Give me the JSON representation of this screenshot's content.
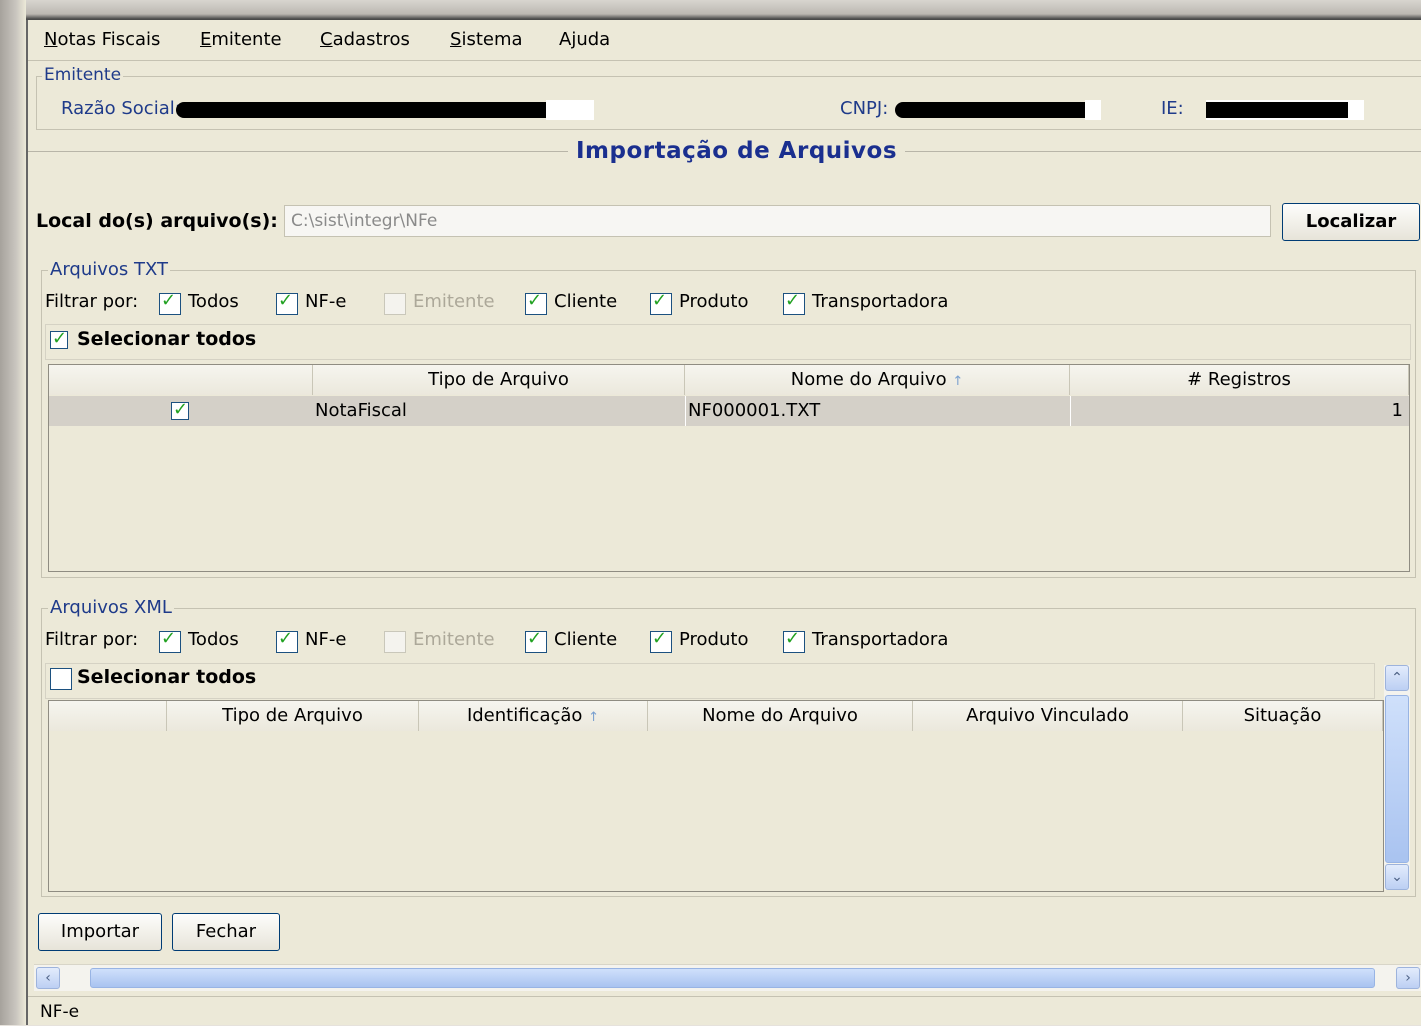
{
  "menu": {
    "items": [
      {
        "label": "Notas Fiscais"
      },
      {
        "label": "Emitente"
      },
      {
        "label": "Cadastros"
      },
      {
        "label": "Sistema"
      },
      {
        "label": "Ajuda"
      }
    ]
  },
  "emitente": {
    "title": "Emitente",
    "razao_label": "Razão Social:",
    "cnpj_label": "CNPJ:",
    "ie_label": "IE:"
  },
  "page": {
    "title": "Importação de Arquivos"
  },
  "local": {
    "label": "Local do(s) arquivo(s):",
    "value": "C:\\sist\\integr\\NFe",
    "button": "Localizar"
  },
  "txt": {
    "title": "Arquivos TXT",
    "filter_label": "Filtrar por:",
    "filters": [
      {
        "label": "Todos",
        "checked": true,
        "enabled": true
      },
      {
        "label": "NF-e",
        "checked": true,
        "enabled": true
      },
      {
        "label": "Emitente",
        "checked": false,
        "enabled": false
      },
      {
        "label": "Cliente",
        "checked": true,
        "enabled": true
      },
      {
        "label": "Produto",
        "checked": true,
        "enabled": true
      },
      {
        "label": "Transportadora",
        "checked": true,
        "enabled": true
      }
    ],
    "select_all": {
      "label": "Selecionar todos",
      "checked": true
    },
    "columns": [
      "",
      "Tipo de Arquivo",
      "Nome do Arquivo",
      "# Registros"
    ],
    "rows": [
      {
        "checked": true,
        "tipo": "NotaFiscal",
        "nome": "NF000001.TXT",
        "registros": "1"
      }
    ]
  },
  "xml": {
    "title": "Arquivos XML",
    "filter_label": "Filtrar por:",
    "filters": [
      {
        "label": "Todos",
        "checked": true,
        "enabled": true
      },
      {
        "label": "NF-e",
        "checked": true,
        "enabled": true
      },
      {
        "label": "Emitente",
        "checked": false,
        "enabled": false
      },
      {
        "label": "Cliente",
        "checked": true,
        "enabled": true
      },
      {
        "label": "Produto",
        "checked": true,
        "enabled": true
      },
      {
        "label": "Transportadora",
        "checked": true,
        "enabled": true
      }
    ],
    "select_all": {
      "label": "Selecionar todos",
      "checked": false
    },
    "columns": [
      "",
      "Tipo de Arquivo",
      "Identificação",
      "Nome do Arquivo",
      "Arquivo Vinculado",
      "Situação"
    ],
    "rows": []
  },
  "buttons": {
    "importar": "Importar",
    "fechar": "Fechar"
  },
  "status": {
    "text": "NF-e"
  },
  "icons": {
    "sort": "sort-up-icon",
    "scroll_up": "chevron-up-icon",
    "scroll_down": "chevron-down-icon",
    "scroll_left": "chevron-left-icon",
    "scroll_right": "chevron-right-icon"
  },
  "colors": {
    "group_title": "#1f3b8a",
    "page_title": "#1a2f8f",
    "background": "#ece9d8",
    "checkmark": "#21a121"
  }
}
